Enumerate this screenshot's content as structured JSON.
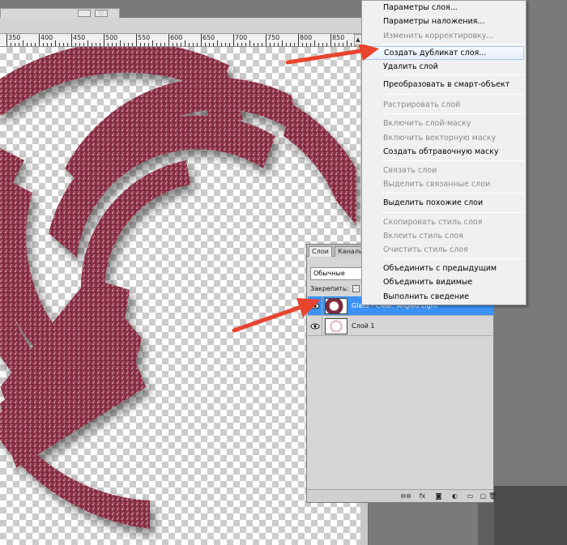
{
  "ruler": {
    "labels": [
      "350",
      "400",
      "450",
      "500",
      "550",
      "600",
      "650",
      "700",
      "750",
      "800",
      "850"
    ]
  },
  "context_menu": {
    "items": [
      {
        "label": "Параметры слоя...",
        "disabled": false
      },
      {
        "label": "Параметры наложения...",
        "disabled": false
      },
      {
        "label": "Изменить корректировку...",
        "disabled": true
      },
      {
        "label": "Создать дубликат слоя...",
        "disabled": false,
        "highlighted": true
      },
      {
        "label": "Удалить слой",
        "disabled": false
      },
      {
        "label": "Преобразовать в смарт-объект",
        "disabled": false
      },
      {
        "label": "Растрировать слой",
        "disabled": true
      },
      {
        "label": "Включить слой-маску",
        "disabled": true
      },
      {
        "label": "Включить векторную маску",
        "disabled": true
      },
      {
        "label": "Создать обтравочную маску",
        "disabled": false
      },
      {
        "label": "Связать слои",
        "disabled": true
      },
      {
        "label": "Выделить связанные слои",
        "disabled": true
      },
      {
        "label": "Выделить похожие слои",
        "disabled": false
      },
      {
        "label": "Скопировать стиль слоя",
        "disabled": true
      },
      {
        "label": "Вклеить стиль слоя",
        "disabled": true
      },
      {
        "label": "Очистить стиль слоя",
        "disabled": true
      },
      {
        "label": "Объединить с предыдущим",
        "disabled": false
      },
      {
        "label": "Объединить видимые",
        "disabled": false
      },
      {
        "label": "Выполнить сведение",
        "disabled": false
      }
    ]
  },
  "layers_panel": {
    "tabs": [
      "Слои",
      "Каналы"
    ],
    "blend_mode": "Обычные",
    "lock_label": "Закрепить:",
    "layers": [
      {
        "name": "Glass - Clear: Angled Light",
        "selected": true,
        "visible": true
      },
      {
        "name": "Слой 1",
        "selected": false,
        "visible": true
      }
    ],
    "footer_icons": [
      "link-icon",
      "fx-icon",
      "mask-icon",
      "adjustment-icon",
      "group-icon",
      "new-layer-icon",
      "trash-icon"
    ],
    "footer_glyphs": [
      "⊖⊖",
      "fx",
      "◙",
      "◐",
      "▭",
      "▢",
      "🗑"
    ]
  },
  "colors": {
    "selection_blue": "#3b93f7",
    "arrow_red": "#e8442e",
    "ring_texture": "#8e3349"
  }
}
